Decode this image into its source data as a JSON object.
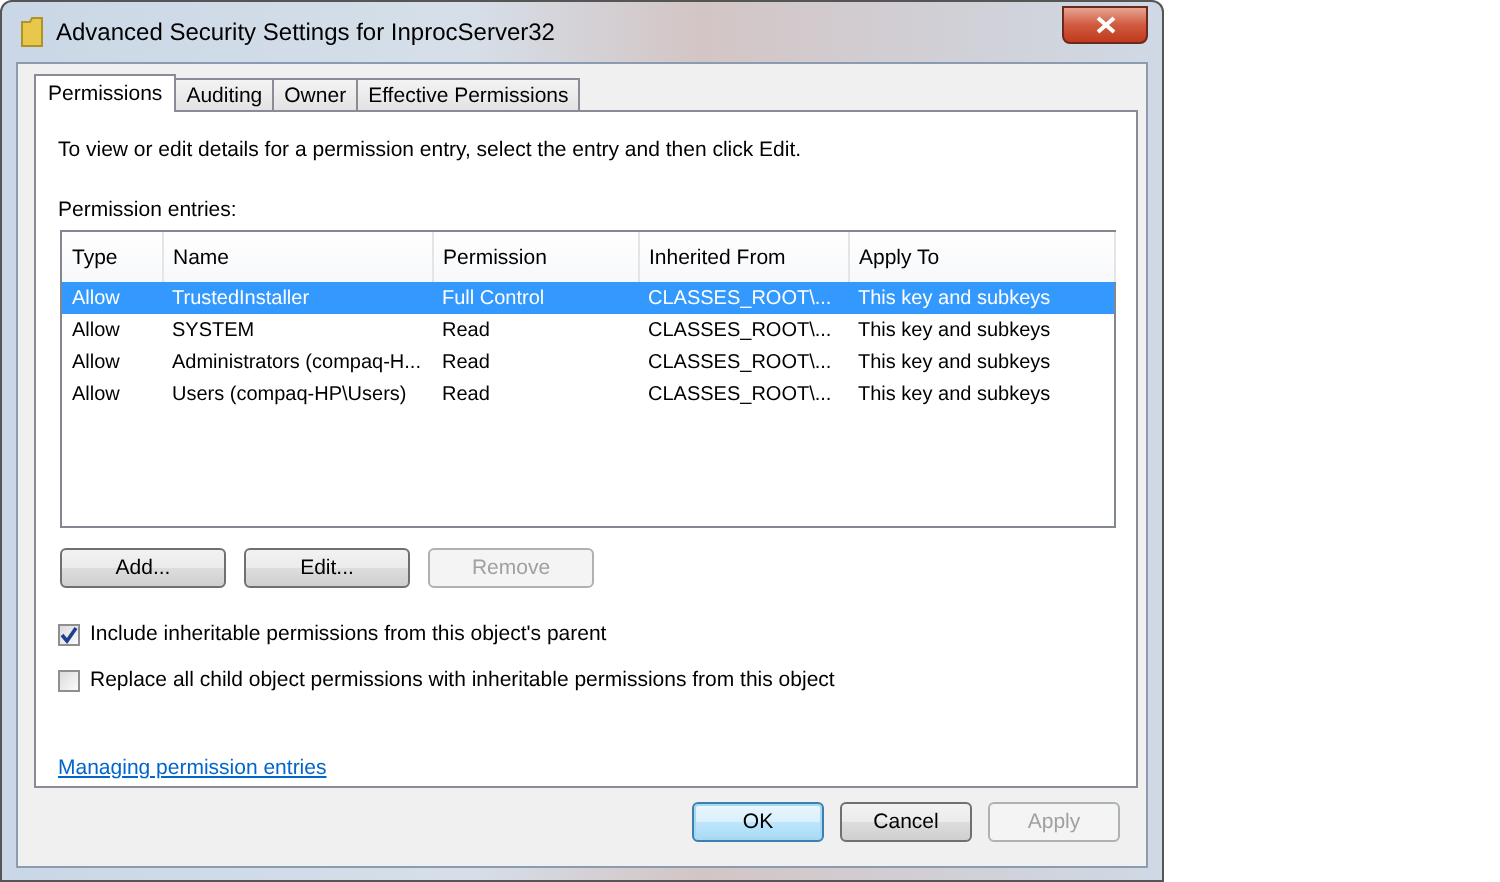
{
  "window": {
    "title": "Advanced Security Settings for InprocServer32"
  },
  "tabs": [
    {
      "label": "Permissions",
      "selected": true
    },
    {
      "label": "Auditing",
      "selected": false
    },
    {
      "label": "Owner",
      "selected": false
    },
    {
      "label": "Effective Permissions",
      "selected": false
    }
  ],
  "instructions": "To view or edit details for a permission entry, select the entry and then click Edit.",
  "list_label": "Permission entries:",
  "table": {
    "columns": [
      "Type",
      "Name",
      "Permission",
      "Inherited From",
      "Apply To"
    ],
    "rows": [
      {
        "cells": [
          "Allow",
          "TrustedInstaller",
          "Full Control",
          "CLASSES_ROOT\\...",
          "This key and subkeys"
        ],
        "selected": true
      },
      {
        "cells": [
          "Allow",
          "SYSTEM",
          "Read",
          "CLASSES_ROOT\\...",
          "This key and subkeys"
        ],
        "selected": false
      },
      {
        "cells": [
          "Allow",
          "Administrators (compaq-H...",
          "Read",
          "CLASSES_ROOT\\...",
          "This key and subkeys"
        ],
        "selected": false
      },
      {
        "cells": [
          "Allow",
          "Users (compaq-HP\\Users)",
          "Read",
          "CLASSES_ROOT\\...",
          "This key and subkeys"
        ],
        "selected": false
      }
    ]
  },
  "entry_buttons": [
    {
      "label": "Add...",
      "disabled": false
    },
    {
      "label": "Edit...",
      "disabled": false
    },
    {
      "label": "Remove",
      "disabled": true
    }
  ],
  "checkboxes": [
    {
      "label": "Include inheritable permissions from this object's parent",
      "checked": true
    },
    {
      "label": "Replace all child object permissions with inheritable permissions from this object",
      "checked": false
    }
  ],
  "link": "Managing permission entries",
  "dialog_buttons": [
    {
      "label": "OK",
      "disabled": false,
      "default": true
    },
    {
      "label": "Cancel",
      "disabled": false,
      "default": false
    },
    {
      "label": "Apply",
      "disabled": true,
      "default": false
    }
  ]
}
